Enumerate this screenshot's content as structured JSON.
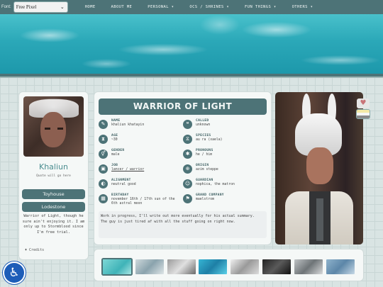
{
  "nav": {
    "font_label": "Font:",
    "font_value": "Free Pixel",
    "items": [
      "HOME",
      "ABOUT ME",
      "PERSONAL ▾",
      "OCS / SHRINES ▾",
      "FUN THINGS ▾",
      "OTHERS ▾"
    ]
  },
  "profile": {
    "name": "Khaliun",
    "quote": "Quote will go here",
    "buttons": [
      "Toyhouse",
      "Lodestone"
    ],
    "bio": "Warrior of Light, though he sure ain't enjoying it. I am only up to Stormblood since I'm free trial.",
    "credits": "♦ Credits"
  },
  "main": {
    "title": "WARRIOR OF LIGHT",
    "fields": [
      {
        "label": "NAME",
        "value": "khaliun khatayin",
        "icon": "pencil-icon",
        "glyph": "✎"
      },
      {
        "label": "CALLED",
        "value": "unknown",
        "icon": "quote-icon",
        "glyph": "❝"
      },
      {
        "label": "AGE",
        "value": "~30",
        "icon": "hourglass-icon",
        "glyph": "⧗"
      },
      {
        "label": "SPECIES",
        "value": "au ra (xaela)",
        "icon": "dna-icon",
        "glyph": "⧖"
      },
      {
        "label": "GENDER",
        "value": "male",
        "icon": "gender-icon",
        "glyph": "⚥"
      },
      {
        "label": "PRONOUNS",
        "value": "he / him",
        "icon": "asterisk-icon",
        "glyph": "✱"
      },
      {
        "label": "JOB",
        "value": "lancer / warrior",
        "icon": "briefcase-icon",
        "glyph": "▣"
      },
      {
        "label": "ORIGIN",
        "value": "azim steppe",
        "icon": "globe-icon",
        "glyph": "⊕"
      },
      {
        "label": "ALIGNMENT",
        "value": "neutral good",
        "icon": "contrast-icon",
        "glyph": "◐"
      },
      {
        "label": "GUARDIAN",
        "value": "nophica, the matron",
        "icon": "user-icon",
        "glyph": "☺"
      },
      {
        "label": "BIRTHDAY",
        "value": "november 16th / 17th sun of the 6th astral moon",
        "icon": "calendar-icon",
        "glyph": "▦"
      },
      {
        "label": "GRAND COMPANY",
        "value": "maelstrom",
        "icon": "flag-icon",
        "glyph": "⚑"
      }
    ],
    "summary": "Work in progress, I'll write out more eventually for his actual summary. The guy is just tired af with all the stuff going on right now."
  },
  "badges": {
    "heart": "♥"
  },
  "accessibility": {
    "glyph": "♿"
  },
  "colors": {
    "accent": "#4d7377",
    "name": "#4a8d90",
    "background": "#d9e4e3"
  }
}
